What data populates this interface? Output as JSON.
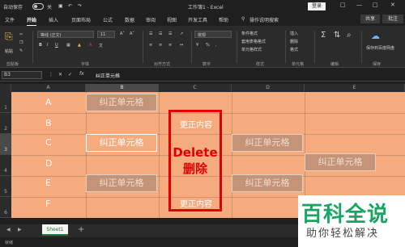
{
  "titlebar": {
    "autosave": "自动保存",
    "toggle": "关",
    "title": "工作簿1 - Excel",
    "login": "登录"
  },
  "menu": {
    "tabs": [
      "文件",
      "开始",
      "插入",
      "页面布局",
      "公式",
      "数据",
      "审阅",
      "视图",
      "开发工具",
      "帮助"
    ],
    "search": "操作说明搜索",
    "share": "共享",
    "comment": "批注"
  },
  "ribbon": {
    "groups": {
      "clipboard": "剪贴板",
      "font": "字体",
      "alignment": "对齐方式",
      "number": "数字",
      "styles": "样式",
      "cells": "单元格",
      "editing": "编辑",
      "save": "保存"
    },
    "font_name": "等线 (正文)",
    "font_size": "11",
    "number_format": "常规",
    "bold": "B",
    "italic": "I",
    "underline": "U",
    "cond_format": "条件格式",
    "table_format": "套用表格格式",
    "cell_style": "单元格样式",
    "insert": "插入",
    "delete": "删除",
    "format": "格式",
    "paste": "粘贴",
    "save_btn": "保存到百度网盘"
  },
  "formula": {
    "name_box": "B3",
    "fx": "fx",
    "value": "纠正单元格"
  },
  "columns": [
    "A",
    "B",
    "C",
    "D",
    "E"
  ],
  "rows": [
    "1",
    "2",
    "3",
    "4",
    "5",
    "6"
  ],
  "grid": {
    "letters": [
      "A",
      "B",
      "C",
      "D",
      "E",
      "F"
    ],
    "cell_label": "纠正单元格",
    "fix_top": "更正内容",
    "fix_bottom": "更正内容",
    "delete_en": "Delete",
    "delete_cn": "删除"
  },
  "sheet": {
    "name": "Sheet1",
    "add": "+"
  },
  "status": {
    "ready": "就绪"
  },
  "watermark": {
    "big": "百科全说",
    "small": "助你轻松解决"
  },
  "colors": {
    "sheet_bg": "#f5ab7e",
    "highlight": "#e00000",
    "brand_green": "#19a463"
  }
}
